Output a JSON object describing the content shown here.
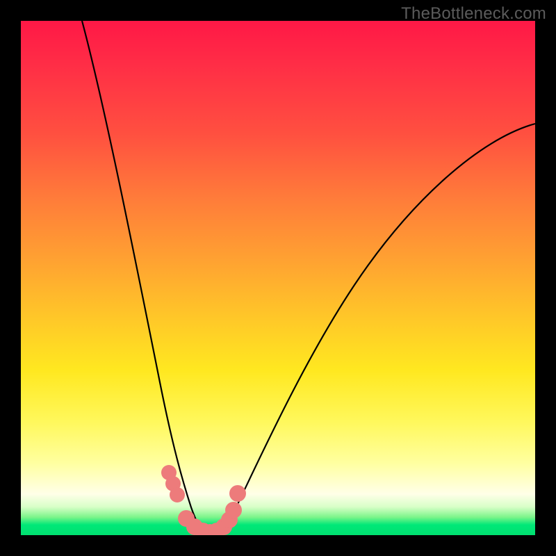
{
  "watermark": "TheBottleneck.com",
  "chart_data": {
    "type": "line",
    "title": "",
    "xlabel": "",
    "ylabel": "",
    "xlim": [
      0,
      100
    ],
    "ylim": [
      0,
      100
    ],
    "series": [
      {
        "name": "bottleneck-curve",
        "color": "#000000",
        "x": [
          12,
          14,
          16,
          18,
          20,
          22,
          24,
          26,
          28,
          30,
          32,
          34,
          35,
          36,
          38,
          40,
          45,
          50,
          55,
          60,
          65,
          70,
          75,
          80,
          85,
          90,
          95,
          100
        ],
        "y": [
          100,
          92,
          84,
          75,
          66,
          57,
          48,
          39,
          30,
          21,
          12,
          5,
          2,
          0,
          0,
          2,
          9,
          18,
          27,
          35,
          43,
          50,
          56,
          62,
          67,
          72,
          76,
          80
        ]
      },
      {
        "name": "marker-cluster",
        "type": "scatter",
        "color": "#ed7b7b",
        "x": [
          28.5,
          29.5,
          30.5,
          32,
          33.5,
          35,
          36,
          37,
          38,
          39,
          40,
          41
        ],
        "y": [
          12,
          10,
          8,
          3,
          1,
          0,
          0,
          0,
          1,
          3,
          6,
          9
        ]
      }
    ],
    "colors": {
      "gradient_top": "#ff1846",
      "gradient_mid": "#ffe820",
      "gradient_bottom": "#00e070",
      "marker": "#ed7b7b",
      "curve": "#000000",
      "frame": "#000000"
    }
  }
}
